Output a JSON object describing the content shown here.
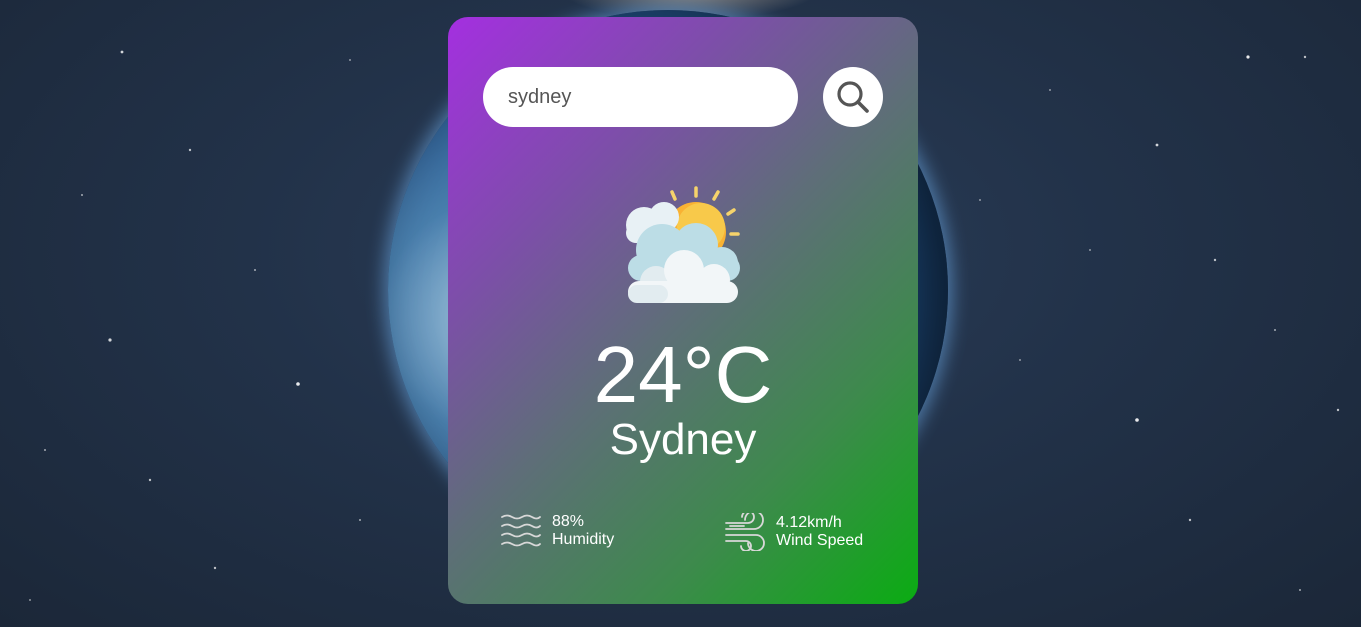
{
  "search": {
    "value": "sydney",
    "button_icon": "search-icon"
  },
  "weather": {
    "icon": "sun-behind-clouds-icon",
    "temperature": "24°C",
    "city": "Sydney"
  },
  "details": {
    "humidity": {
      "icon": "humidity-waves-icon",
      "value": "88%",
      "label": "Humidity"
    },
    "wind": {
      "icon": "wind-icon",
      "value": "4.12km/h",
      "label": "Wind Speed"
    }
  },
  "colors": {
    "card_gradient_start": "#a42fe0",
    "card_gradient_end": "#0aac12",
    "background": "#223249"
  }
}
